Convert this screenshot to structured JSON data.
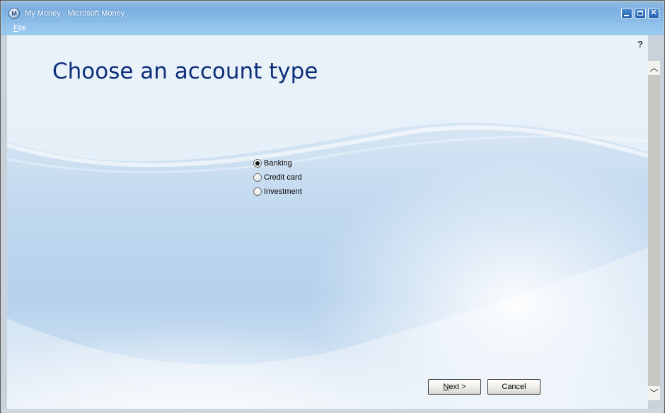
{
  "window": {
    "title": "My Money - Microsoft Money",
    "app_icon_letter": "M",
    "controls": [
      "minimize",
      "maximize",
      "close"
    ]
  },
  "menubar": {
    "items": [
      {
        "label": "File",
        "accelerator": "F"
      }
    ]
  },
  "page": {
    "title": "Choose an account type",
    "help": "?"
  },
  "account_types": {
    "options": [
      {
        "label": "Banking",
        "checked": true
      },
      {
        "label": "Credit card",
        "checked": false
      },
      {
        "label": "Investment",
        "checked": false
      }
    ]
  },
  "buttons": {
    "next": {
      "prefix": "",
      "accel": "N",
      "rest": "ext >"
    },
    "cancel": {
      "label": "Cancel"
    }
  },
  "colors": {
    "title_text": "#0e2f7a",
    "titlebar": "#7eb2e2",
    "background": "#c2d9ef"
  },
  "icons": [
    "money-app-icon",
    "minimize-icon",
    "maximize-icon",
    "close-icon",
    "help-icon",
    "scroll-up-icon",
    "scroll-down-icon"
  ]
}
